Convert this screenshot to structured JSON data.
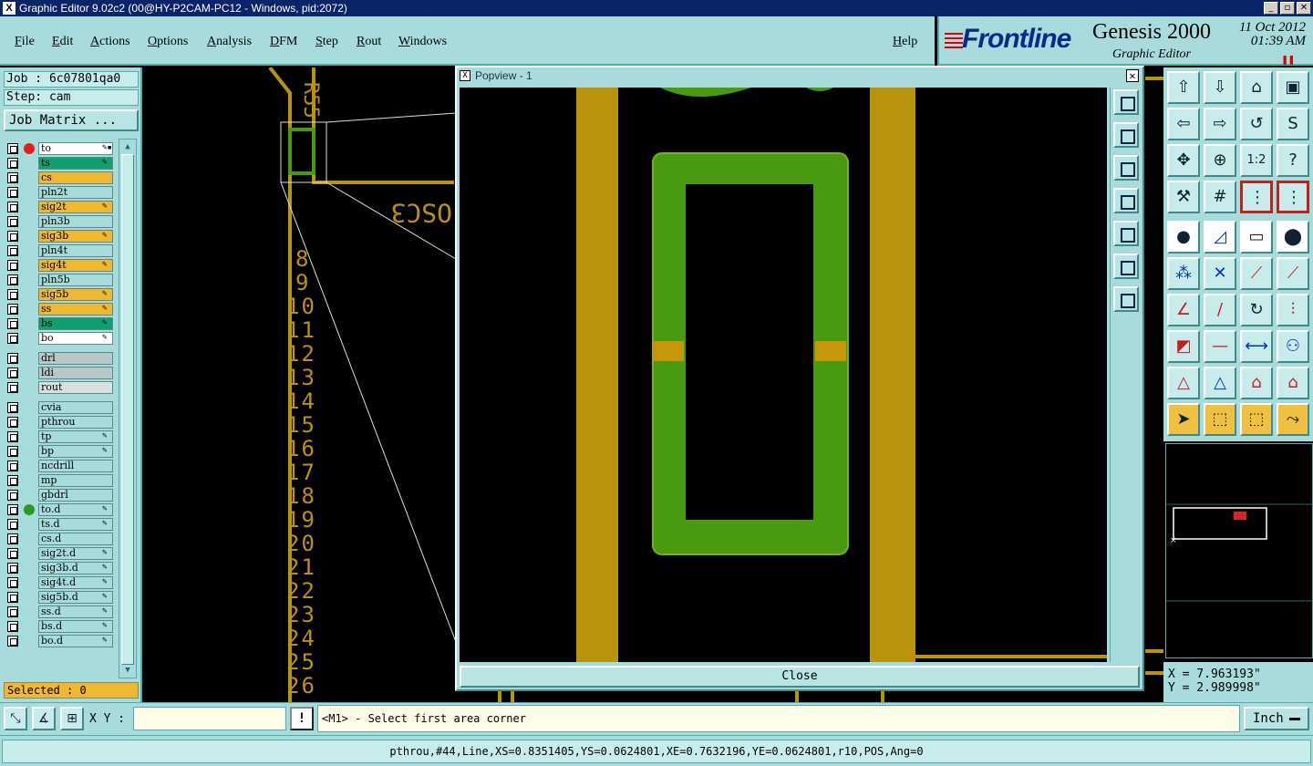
{
  "window": {
    "title": "Graphic Editor 9.02c2 (00@HY-P2CAM-PC12 - Windows, pid:2072)",
    "app_icon": "X"
  },
  "menu": [
    "File",
    "Edit",
    "Actions",
    "Options",
    "Analysis",
    "DFM",
    "Step",
    "Rout",
    "Windows"
  ],
  "help_label": "Help",
  "brand": {
    "logo": "Frontline",
    "product": "Genesis 2000",
    "subtitle": "Graphic Editor",
    "date": "11 Oct 2012",
    "time": "01:39 AM",
    "pause_icon": "pause-icon"
  },
  "left_panel": {
    "job": "Job : 6c07801qa0",
    "step": "Step: cam",
    "job_matrix_label": "Job Matrix ...",
    "selected": "Selected : 0"
  },
  "layers": [
    {
      "name": "to",
      "color": "#ffffff",
      "dot": "#e02020",
      "flag": "✎▪"
    },
    {
      "name": "ts",
      "color": "#10a070",
      "flag": "✎"
    },
    {
      "name": "cs",
      "color": "#f0b830",
      "flag": ""
    },
    {
      "name": "pln2t",
      "color": "#a8dcdc",
      "flag": ""
    },
    {
      "name": "sig2t",
      "color": "#f0b830",
      "flag": "✎"
    },
    {
      "name": "pln3b",
      "color": "#a8dcdc",
      "flag": ""
    },
    {
      "name": "sig3b",
      "color": "#f0b830",
      "flag": "✎"
    },
    {
      "name": "pln4t",
      "color": "#a8dcdc",
      "flag": ""
    },
    {
      "name": "sig4t",
      "color": "#f0b830",
      "flag": "✎"
    },
    {
      "name": "pln5b",
      "color": "#a8dcdc",
      "flag": ""
    },
    {
      "name": "sig5b",
      "color": "#f0b830",
      "flag": "✎"
    },
    {
      "name": "ss",
      "color": "#f0b830",
      "flag": "✎"
    },
    {
      "name": "bs",
      "color": "#10a070",
      "flag": "✎"
    },
    {
      "name": "bo",
      "color": "#ffffff",
      "flag": "✎"
    },
    {
      "name": "drl",
      "color": "#b8c8c8",
      "flag": ""
    },
    {
      "name": "ldi",
      "color": "#b8c8c8",
      "flag": ""
    },
    {
      "name": "rout",
      "color": "#d8e0e0",
      "flag": ""
    },
    {
      "name": "cvia",
      "color": "#a8dcdc",
      "flag": ""
    },
    {
      "name": "pthrou",
      "color": "#a8dcdc",
      "flag": ""
    },
    {
      "name": "tp",
      "color": "#a8dcdc",
      "flag": "✎"
    },
    {
      "name": "bp",
      "color": "#a8dcdc",
      "flag": "✎"
    },
    {
      "name": "ncdrill",
      "color": "#a8dcdc",
      "flag": ""
    },
    {
      "name": "mp",
      "color": "#a8dcdc",
      "flag": ""
    },
    {
      "name": "gbdrl",
      "color": "#a8dcdc",
      "flag": ""
    },
    {
      "name": "to.d",
      "color": "#a8dcdc",
      "dot": "#2a9a20",
      "flag": "✎"
    },
    {
      "name": "ts.d",
      "color": "#a8dcdc",
      "flag": "✎"
    },
    {
      "name": "cs.d",
      "color": "#a8dcdc",
      "flag": ""
    },
    {
      "name": "sig2t.d",
      "color": "#a8dcdc",
      "flag": "✎"
    },
    {
      "name": "sig3b.d",
      "color": "#a8dcdc",
      "flag": "✎"
    },
    {
      "name": "sig4t.d",
      "color": "#a8dcdc",
      "flag": "✎"
    },
    {
      "name": "sig5b.d",
      "color": "#a8dcdc",
      "flag": "✎"
    },
    {
      "name": "ss.d",
      "color": "#a8dcdc",
      "flag": "✎"
    },
    {
      "name": "bs.d",
      "color": "#a8dcdc",
      "flag": "✎"
    },
    {
      "name": "bo.d",
      "color": "#a8dcdc",
      "flag": "✎"
    }
  ],
  "canvas": {
    "ref_label": "R55",
    "osc_label": "OSC3",
    "pin_numbers": [
      "8",
      "9",
      "10",
      "11",
      "12",
      "13",
      "14",
      "15",
      "16",
      "17",
      "18",
      "19",
      "20",
      "21",
      "22",
      "23",
      "24",
      "25",
      "26"
    ]
  },
  "popview": {
    "title": "Popview - 1",
    "close_label": "Close"
  },
  "coords": {
    "x": "X = 7.963193\"",
    "y": "Y = 2.989998\""
  },
  "command": {
    "xy_label": "X Y :",
    "xy_value": "",
    "prompt": "<M1> - Select first area corner",
    "units": "Inch"
  },
  "status": "pthrou,#44,Line,XS=0.8351405,YS=0.0624801,XE=0.7632196,YE=0.0624801,r10,POS,Ang=0"
}
